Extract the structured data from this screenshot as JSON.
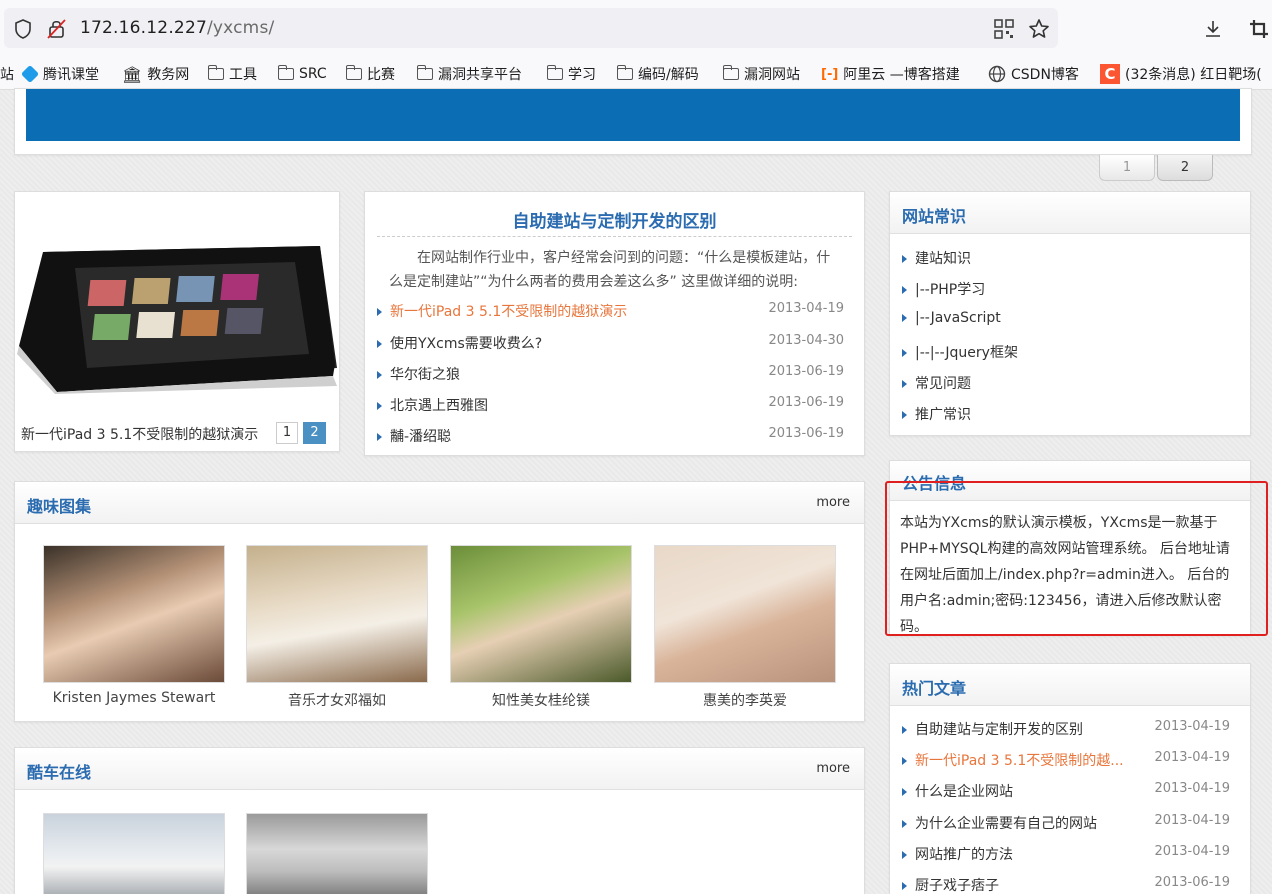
{
  "browser": {
    "url_host": "172.16.12.227",
    "url_path": "/yxcms/",
    "bookmarks": [
      "站",
      "腾讯课堂",
      "教务网",
      "工具",
      "SRC",
      "比赛",
      "漏洞共享平台",
      "学习",
      "编码/解码",
      "漏洞网站",
      "阿里云 —博客搭建",
      "CSDN博客",
      "(32条消息) 红日靶场("
    ]
  },
  "banner": {
    "pages": [
      "1",
      "2"
    ]
  },
  "slider": {
    "caption": "新一代iPad 3 5.1不受限制的越狱演示",
    "pages": [
      "1",
      "2"
    ]
  },
  "featured": {
    "title": "自助建站与定制开发的区别",
    "summary": "在网站制作行业中，客户经常会问到的问题：“什么是模板建站，什么是定制建站”“为什么两者的费用会差这么多” 这里做详细的说明:",
    "items": [
      {
        "title": "新一代iPad 3 5.1不受限制的越狱演示",
        "date": "2013-04-19"
      },
      {
        "title": "使用YXcms需要收费么?",
        "date": "2013-04-30"
      },
      {
        "title": "华尔街之狼",
        "date": "2013-06-19"
      },
      {
        "title": "北京遇上西雅图",
        "date": "2013-06-19"
      },
      {
        "title": "黼-潘绍聪",
        "date": "2013-06-19"
      }
    ]
  },
  "gallery": {
    "title": "趣味图集",
    "more": "more",
    "items": [
      "Kristen Jaymes Stewart",
      "音乐才女邓福如",
      "知性美女桂纶镁",
      "惠美的李英爱"
    ]
  },
  "cars": {
    "title": "酷车在线",
    "more": "more"
  },
  "knowledge": {
    "title": "网站常识",
    "items": [
      "建站知识",
      "|--PHP学习",
      "|--JavaScript",
      "|--|--Jquery框架",
      "常见问题",
      "推广常识"
    ]
  },
  "notice": {
    "title": "公告信息",
    "text": "本站为YXcms的默认演示模板，YXcms是一款基于PHP+MYSQL构建的高效网站管理系统。 后台地址请在网址后面加上/index.php?r=admin进入。 后台的用户名:admin;密码:123456，请进入后修改默认密码。"
  },
  "hot": {
    "title": "热门文章",
    "items": [
      {
        "title": "自助建站与定制开发的区别",
        "date": "2013-04-19"
      },
      {
        "title": "新一代iPad 3 5.1不受限制的越...",
        "date": "2013-04-19"
      },
      {
        "title": "什么是企业网站",
        "date": "2013-04-19"
      },
      {
        "title": "为什么企业需要有自己的网站",
        "date": "2013-04-19"
      },
      {
        "title": "网站推广的方法",
        "date": "2013-04-19"
      },
      {
        "title": "厨子戏子痞子",
        "date": "2013-06-19"
      }
    ]
  },
  "colors": {
    "accent": "#2b6cb0",
    "highlight": "#e8763c",
    "banner": "#0b6db3",
    "annotation": "#e02020"
  }
}
